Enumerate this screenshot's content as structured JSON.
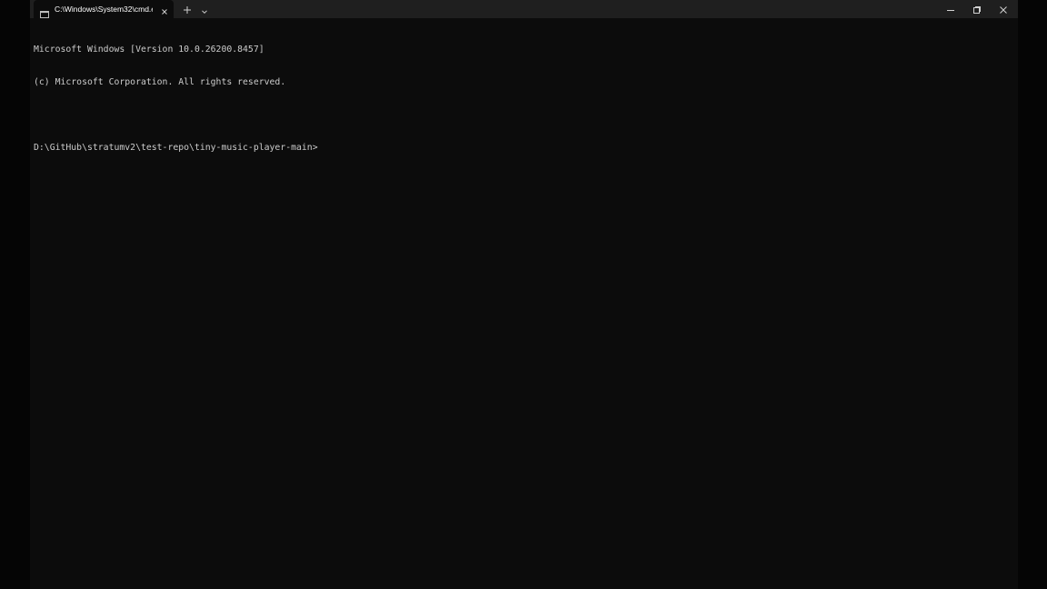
{
  "tab": {
    "title": "C:\\Windows\\System32\\cmd.e"
  },
  "console": {
    "lines": [
      "Microsoft Windows [Version 10.0.26200.8457]",
      "(c) Microsoft Corporation. All rights reserved.",
      "",
      "D:\\GitHub\\stratumv2\\test-repo\\tiny-music-player-main>"
    ]
  },
  "colors": {
    "background": "#0c0c0c",
    "titlebar": "#1f1f1f",
    "text": "#cccccc"
  },
  "icons": [
    "terminal-icon",
    "close-icon",
    "plus-icon",
    "chevron-down-icon",
    "minimize-icon",
    "maximize-icon",
    "close-window-icon"
  ]
}
